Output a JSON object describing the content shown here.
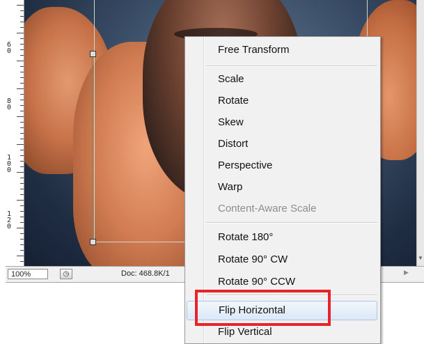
{
  "ruler": {
    "labels": [
      "6\n0",
      "8\n0",
      "1\n0\n0",
      "1\n2\n0"
    ]
  },
  "status_bar": {
    "zoom": "100%",
    "doc_info": "Doc: 468.8K/1"
  },
  "context_menu": {
    "items": [
      {
        "label": "Free Transform",
        "enabled": true
      },
      {
        "label": "Scale",
        "enabled": true
      },
      {
        "label": "Rotate",
        "enabled": true
      },
      {
        "label": "Skew",
        "enabled": true
      },
      {
        "label": "Distort",
        "enabled": true
      },
      {
        "label": "Perspective",
        "enabled": true
      },
      {
        "label": "Warp",
        "enabled": true
      },
      {
        "label": "Content-Aware Scale",
        "enabled": false
      },
      {
        "label": "Rotate 180°",
        "enabled": true
      },
      {
        "label": "Rotate 90° CW",
        "enabled": true
      },
      {
        "label": "Rotate 90° CCW",
        "enabled": true
      },
      {
        "label": "Flip Horizontal",
        "enabled": true,
        "highlighted": true
      },
      {
        "label": "Flip Vertical",
        "enabled": true
      }
    ]
  },
  "colors": {
    "highlight_annotation": "#e8232a",
    "menu_background": "#f1f1f1",
    "menu_hover": "#dbe8f6"
  }
}
